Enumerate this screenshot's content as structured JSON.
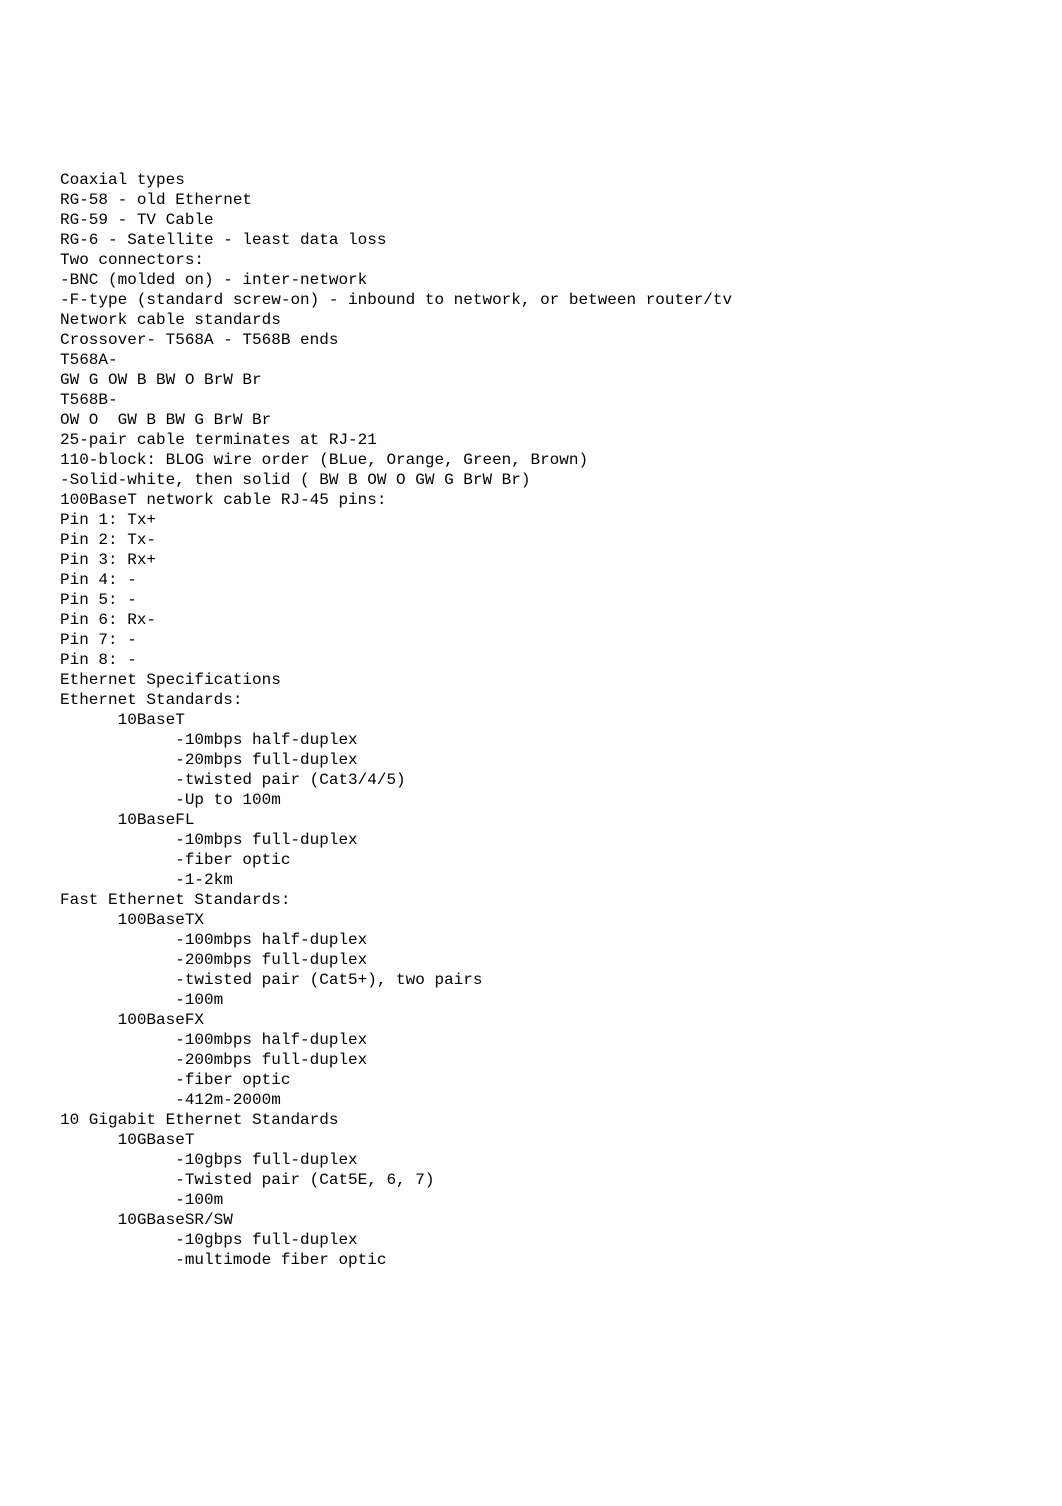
{
  "lines": [
    "Coaxial types",
    "RG-58 - old Ethernet",
    "RG-59 - TV Cable",
    "RG-6 - Satellite - least data loss",
    "Two connectors:",
    "-BNC (molded on) - inter-network",
    "-F-type (standard screw-on) - inbound to network, or between router/tv",
    "",
    "Network cable standards",
    "",
    "Crossover- T568A - T568B ends",
    "",
    "T568A-",
    "GW G OW B BW O BrW Br",
    "",
    "T568B-",
    "OW O  GW B BW G BrW Br",
    "",
    "25-pair cable terminates at RJ-21",
    "",
    "110-block: BLOG wire order (BLue, Orange, Green, Brown)",
    "-Solid-white, then solid ( BW B OW O GW G BrW Br)",
    "",
    "100BaseT network cable RJ-45 pins:",
    "Pin 1: Tx+",
    "Pin 2: Tx-",
    "Pin 3: Rx+",
    "Pin 4: -",
    "Pin 5: -",
    "Pin 6: Rx-",
    "Pin 7: -",
    "Pin 8: -",
    "",
    "Ethernet Specifications",
    "Ethernet Standards:",
    "      10BaseT",
    "",
    "            -10mbps half-duplex",
    "            -20mbps full-duplex",
    "            -twisted pair (Cat3/4/5)",
    "            -Up to 100m",
    "      10BaseFL",
    "            -10mbps full-duplex",
    "            -fiber optic",
    "            -1-2km",
    "Fast Ethernet Standards:",
    "      100BaseTX",
    "            -100mbps half-duplex",
    "            -200mbps full-duplex",
    "            -twisted pair (Cat5+), two pairs",
    "            -100m",
    "      100BaseFX",
    "            -100mbps half-duplex",
    "            -200mbps full-duplex",
    "            -fiber optic",
    "            -412m-2000m",
    "10 Gigabit Ethernet Standards",
    "      10GBaseT",
    "            -10gbps full-duplex",
    "            -Twisted pair (Cat5E, 6, 7)",
    "            -100m",
    "      10GBaseSR/SW",
    "            -10gbps full-duplex",
    "            -multimode fiber optic"
  ]
}
